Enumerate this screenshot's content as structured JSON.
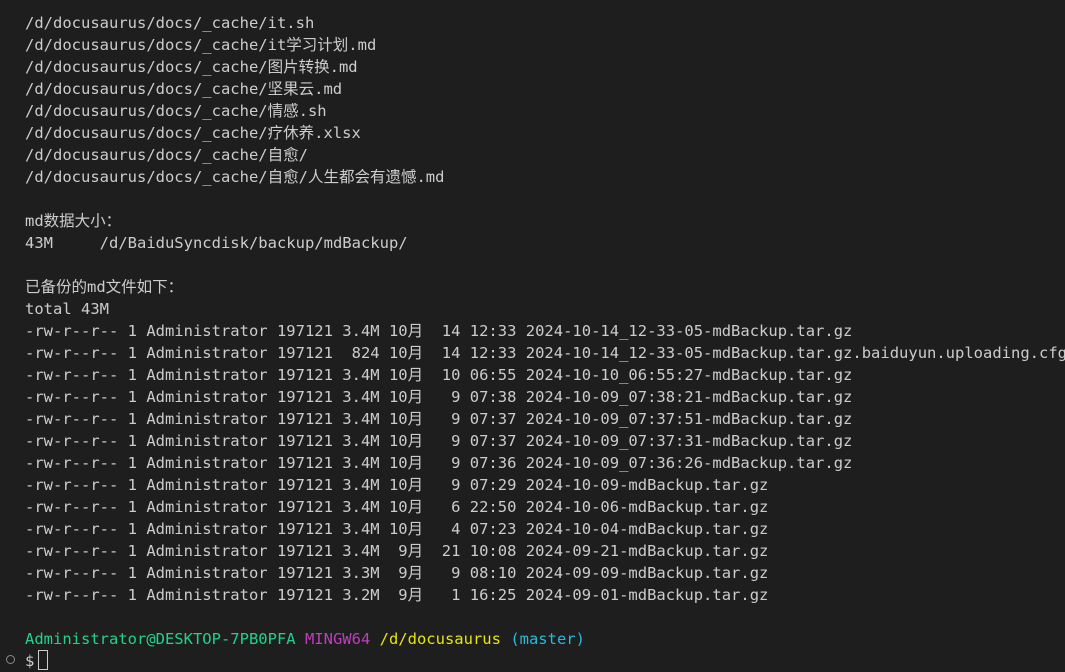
{
  "file_list": [
    "/d/docusaurus/docs/_cache/it.sh",
    "/d/docusaurus/docs/_cache/it学习计划.md",
    "/d/docusaurus/docs/_cache/图片转换.md",
    "/d/docusaurus/docs/_cache/坚果云.md",
    "/d/docusaurus/docs/_cache/情感.sh",
    "/d/docusaurus/docs/_cache/疗休养.xlsx",
    "/d/docusaurus/docs/_cache/自愈/",
    "/d/docusaurus/docs/_cache/自愈/人生都会有遗憾.md"
  ],
  "md_size": {
    "heading": "md数据大小：",
    "line": "43M     /d/BaiduSyncdisk/backup/mdBackup/"
  },
  "backup_list": {
    "heading": "已备份的md文件如下：",
    "total": "total 43M",
    "rows": [
      "-rw-r--r-- 1 Administrator 197121 3.4M 10月  14 12:33 2024-10-14_12-33-05-mdBackup.tar.gz",
      "-rw-r--r-- 1 Administrator 197121  824 10月  14 12:33 2024-10-14_12-33-05-mdBackup.tar.gz.baiduyun.uploading.cfg",
      "-rw-r--r-- 1 Administrator 197121 3.4M 10月  10 06:55 2024-10-10_06:55:27-mdBackup.tar.gz",
      "-rw-r--r-- 1 Administrator 197121 3.4M 10月   9 07:38 2024-10-09_07:38:21-mdBackup.tar.gz",
      "-rw-r--r-- 1 Administrator 197121 3.4M 10月   9 07:37 2024-10-09_07:37:51-mdBackup.tar.gz",
      "-rw-r--r-- 1 Administrator 197121 3.4M 10月   9 07:37 2024-10-09_07:37:31-mdBackup.tar.gz",
      "-rw-r--r-- 1 Administrator 197121 3.4M 10月   9 07:36 2024-10-09_07:36:26-mdBackup.tar.gz",
      "-rw-r--r-- 1 Administrator 197121 3.4M 10月   9 07:29 2024-10-09-mdBackup.tar.gz",
      "-rw-r--r-- 1 Administrator 197121 3.4M 10月   6 22:50 2024-10-06-mdBackup.tar.gz",
      "-rw-r--r-- 1 Administrator 197121 3.4M 10月   4 07:23 2024-10-04-mdBackup.tar.gz",
      "-rw-r--r-- 1 Administrator 197121 3.4M  9月  21 10:08 2024-09-21-mdBackup.tar.gz",
      "-rw-r--r-- 1 Administrator 197121 3.3M  9月   9 08:10 2024-09-09-mdBackup.tar.gz",
      "-rw-r--r-- 1 Administrator 197121 3.2M  9月   1 16:25 2024-09-01-mdBackup.tar.gz"
    ]
  },
  "prompt": {
    "user_host": "Administrator@DESKTOP-7PB0PFA",
    "msystem": "MINGW64",
    "path": "/d/docusaurus",
    "branch": "(master)",
    "symbol": "$"
  },
  "colors": {
    "background": "#1e1e1e",
    "foreground": "#cccccc",
    "user_host": "#23d18b",
    "msystem": "#bc3fbc",
    "path": "#e5e510",
    "branch": "#29b8db"
  }
}
